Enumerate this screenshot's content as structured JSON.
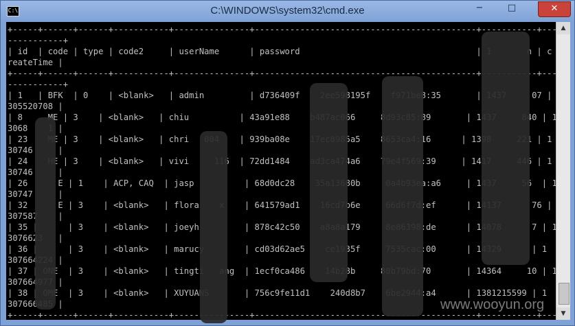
{
  "window": {
    "title": "C:\\WINDOWS\\system32\\cmd.exe",
    "icon_text": "C:\\",
    "minimize": "−",
    "maximize": "□",
    "close": "✕"
  },
  "console": {
    "lines": [
      "+-----+------+------+-----------+---------------+--------------------------------------------+-----------+---",
      "-----------+",
      "| id  | code | type | code2     | userName      | password                                   | 1       n | c",
      "reateTime |",
      "+-----+------+------+-----------+---------------+--------------------------------------------+-----------+---",
      "-----------+",
      "| 1   | BFK  | 0    | <blank>   | admin         | d736409f    2ee598195f    f971be8:35       | 1437     07 | 1",
      "305520708 |",
      "| 8     ME | 3    | <blank>   | chiu          | 43a91e88    b487ac066     8d93c85:89       | 1437     840 | 1",
      "3068    1 |",
      "| 23    ME | 3    | <blank>   | chri   004    | 939ba08e    17ec8985a5    8653ca4:16      | 1398     221 | 1",
      "30746     |",
      "| 24    HE | 3    | <blank>   | vivi     116  | 72dd1484    ad3ca474a6    79e4f569:39     | 1417     446 | 1",
      "30746     |",
      "| 26      E | 1    | ACP, CAQ  | jasp          | 68d0dc28    35a13680b     0a4b93ea:a6     | 1437     56  | 1",
      "30747     |",
      "| 32      E | 3    | <blank>   | flora    x    | 641579ad1    16cd7b6e     66d6f7d:ef      | 14137      76 | 1",
      "307587    |",
      "| 35 |      | 3    | <blank>   | joeyh         | 878c42c50    a8a8a179     8e86398:de      | 14078      7 | 1",
      "3076623   |",
      "| 36 |      | 3    | <blank>   | marucy        | cd03d62ae5    ce1935f     7535cac:00      | 14329      | 1",
      "307664224 |",
      "| 37 | ONE  | 3    | <blank>   | tingti   ang  | 1ecf0ca486    14b28b     80b79bd:70       | 14364     10 | 1",
      "307664977 |",
      "| 38 | OME  | 3    | <blank>   | XUYUANS       | 756c9fe11d1    240d8b7    6be2944:a4      | 1381215599 | 1",
      "307666485 |",
      "+-----+------+------+-----------+---------------+--------------------------------------------+-----------+---"
    ]
  },
  "watermark": "www.wooyun.org"
}
